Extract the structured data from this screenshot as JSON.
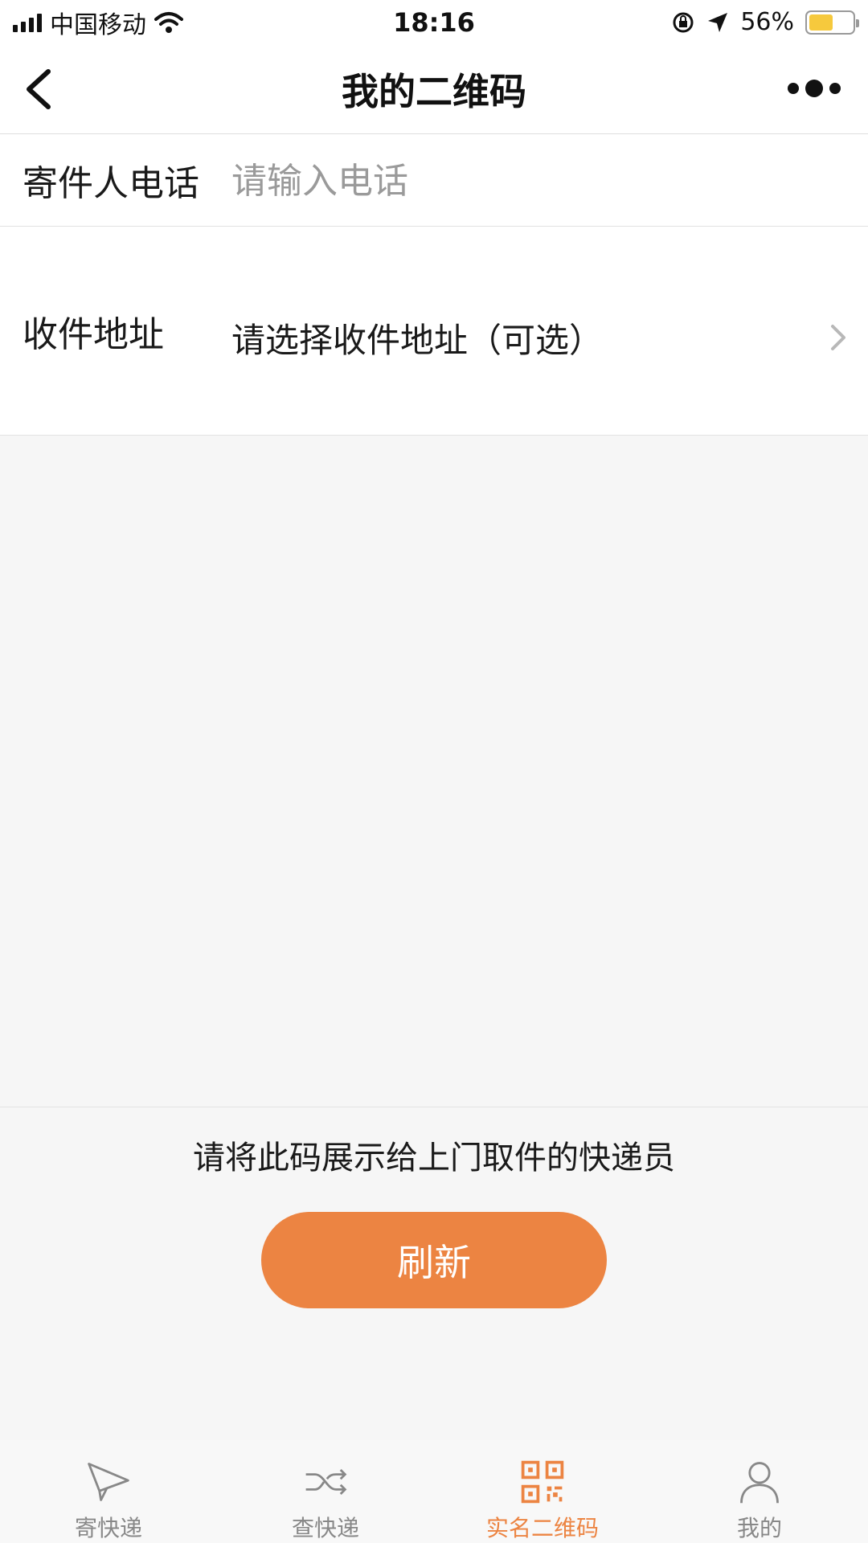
{
  "status_bar": {
    "carrier": "中国移动",
    "time": "18:16",
    "battery": "56%",
    "battery_level": 0.56
  },
  "nav": {
    "title": "我的二维码"
  },
  "form": {
    "phone": {
      "label": "寄件人电话",
      "value": "",
      "placeholder": "请输入电话"
    },
    "address": {
      "label": "收件地址",
      "value": "请选择收件地址（可选）"
    }
  },
  "hint": "请将此码展示给上门取件的快递员",
  "refresh_label": "刷新",
  "tabs": [
    {
      "label": "寄快递",
      "icon": "paper-plane-icon"
    },
    {
      "label": "查快递",
      "icon": "shuffle-icon"
    },
    {
      "label": "实名二维码",
      "icon": "qrcode-icon",
      "active": true
    },
    {
      "label": "我的",
      "icon": "user-icon"
    }
  ],
  "colors": {
    "accent": "#ec8442",
    "battery_fill": "#f6c93d"
  }
}
